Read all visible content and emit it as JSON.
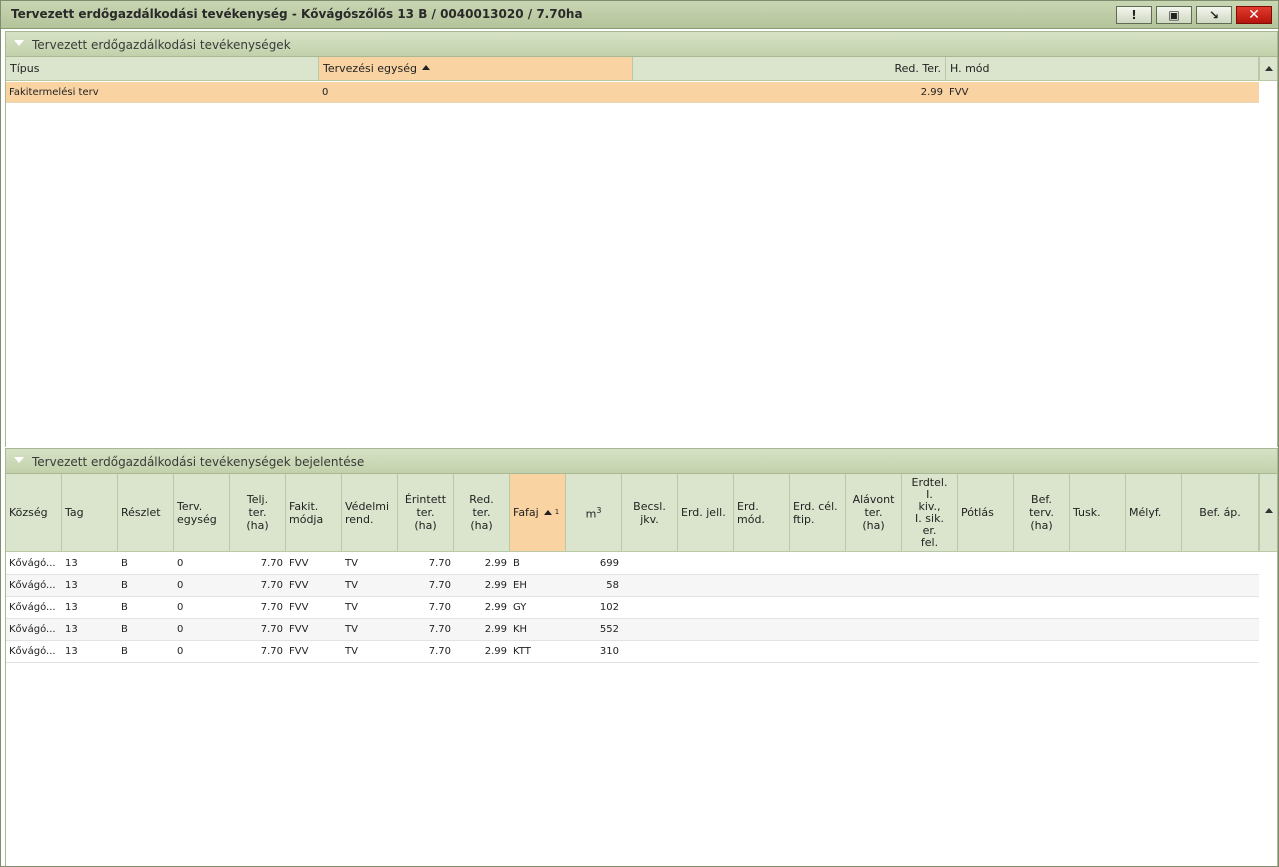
{
  "window": {
    "title": "Tervezett erdőgazdálkodási tevékenység - Kővágószőlős 13 B / 0040013020 / 7.70ha",
    "buttons": {
      "info": "!",
      "save": "▣",
      "minimize": "↘",
      "close": "✕"
    }
  },
  "section_top": {
    "title": "Tervezett erdőgazdálkodási tevékenységek",
    "columns": {
      "tipus": "Típus",
      "tervezesi_egyseg": "Tervezési egység",
      "red_ter": "Red. Ter.",
      "h_mod": "H. mód"
    },
    "rows": [
      {
        "tipus": "Fakitermelési terv",
        "tervezesi_egyseg": "0",
        "red_ter": "2.99",
        "h_mod": "FVV"
      }
    ]
  },
  "section_bottom": {
    "title": "Tervezett erdőgazdálkodási tevékenységek bejelentése",
    "columns": {
      "kozseg": "Község",
      "tag": "Tag",
      "reszlet": "Részlet",
      "terv_egyseg_1": "Terv.",
      "terv_egyseg_2": "egység",
      "telj_ter_1": "Telj.",
      "telj_ter_2": "ter.",
      "telj_ter_3": "(ha)",
      "fakit_modja_1": "Fakit.",
      "fakit_modja_2": "módja",
      "vedelmi_1": "Védelmi",
      "vedelmi_2": "rend.",
      "erintett_1": "Érintett",
      "erintett_2": "ter.",
      "erintett_3": "(ha)",
      "red_ter_1": "Red.",
      "red_ter_2": "ter.",
      "red_ter_3": "(ha)",
      "fafaj": "Fafaj",
      "fafaj_sort_index": "1",
      "m3": "m",
      "m3_sup": "3",
      "becsl_1": "Becsl.",
      "becsl_2": "jkv.",
      "erd_jell": "Erd. jell.",
      "erd_mod_1": "Erd.",
      "erd_mod_2": "mód.",
      "erd_cel_1": "Erd. cél.",
      "erd_cel_2": "ftip.",
      "alavont_1": "Alávont",
      "alavont_2": "ter.",
      "alavont_3": "(ha)",
      "erdtel_1": "Erdtel.",
      "erdtel_2": "I.",
      "erdtel_3": "kiv.,",
      "erdtel_4": "I. sik.",
      "erdtel_5": "er.",
      "erdtel_6": "fel.",
      "potlas": "Pótlás",
      "bef_terv_1": "Bef.",
      "bef_terv_2": "terv.",
      "bef_terv_3": "(ha)",
      "tusk": "Tusk.",
      "melyf": "Mélyf.",
      "bef_ap": "Bef. áp."
    },
    "rows": [
      {
        "kozseg": "Kővágó...",
        "tag": "13",
        "reszlet": "B",
        "terv_egyseg": "0",
        "telj_ter": "7.70",
        "fakit_modja": "FVV",
        "vedelmi": "TV",
        "erintett": "7.70",
        "red_ter": "2.99",
        "fafaj": "B",
        "m3": "699"
      },
      {
        "kozseg": "Kővágó...",
        "tag": "13",
        "reszlet": "B",
        "terv_egyseg": "0",
        "telj_ter": "7.70",
        "fakit_modja": "FVV",
        "vedelmi": "TV",
        "erintett": "7.70",
        "red_ter": "2.99",
        "fafaj": "EH",
        "m3": "58"
      },
      {
        "kozseg": "Kővágó...",
        "tag": "13",
        "reszlet": "B",
        "terv_egyseg": "0",
        "telj_ter": "7.70",
        "fakit_modja": "FVV",
        "vedelmi": "TV",
        "erintett": "7.70",
        "red_ter": "2.99",
        "fafaj": "GY",
        "m3": "102"
      },
      {
        "kozseg": "Kővágó...",
        "tag": "13",
        "reszlet": "B",
        "terv_egyseg": "0",
        "telj_ter": "7.70",
        "fakit_modja": "FVV",
        "vedelmi": "TV",
        "erintett": "7.70",
        "red_ter": "2.99",
        "fafaj": "KH",
        "m3": "552"
      },
      {
        "kozseg": "Kővágó...",
        "tag": "13",
        "reszlet": "B",
        "terv_egyseg": "0",
        "telj_ter": "7.70",
        "fakit_modja": "FVV",
        "vedelmi": "TV",
        "erintett": "7.70",
        "red_ter": "2.99",
        "fafaj": "KTT",
        "m3": "310"
      }
    ]
  }
}
